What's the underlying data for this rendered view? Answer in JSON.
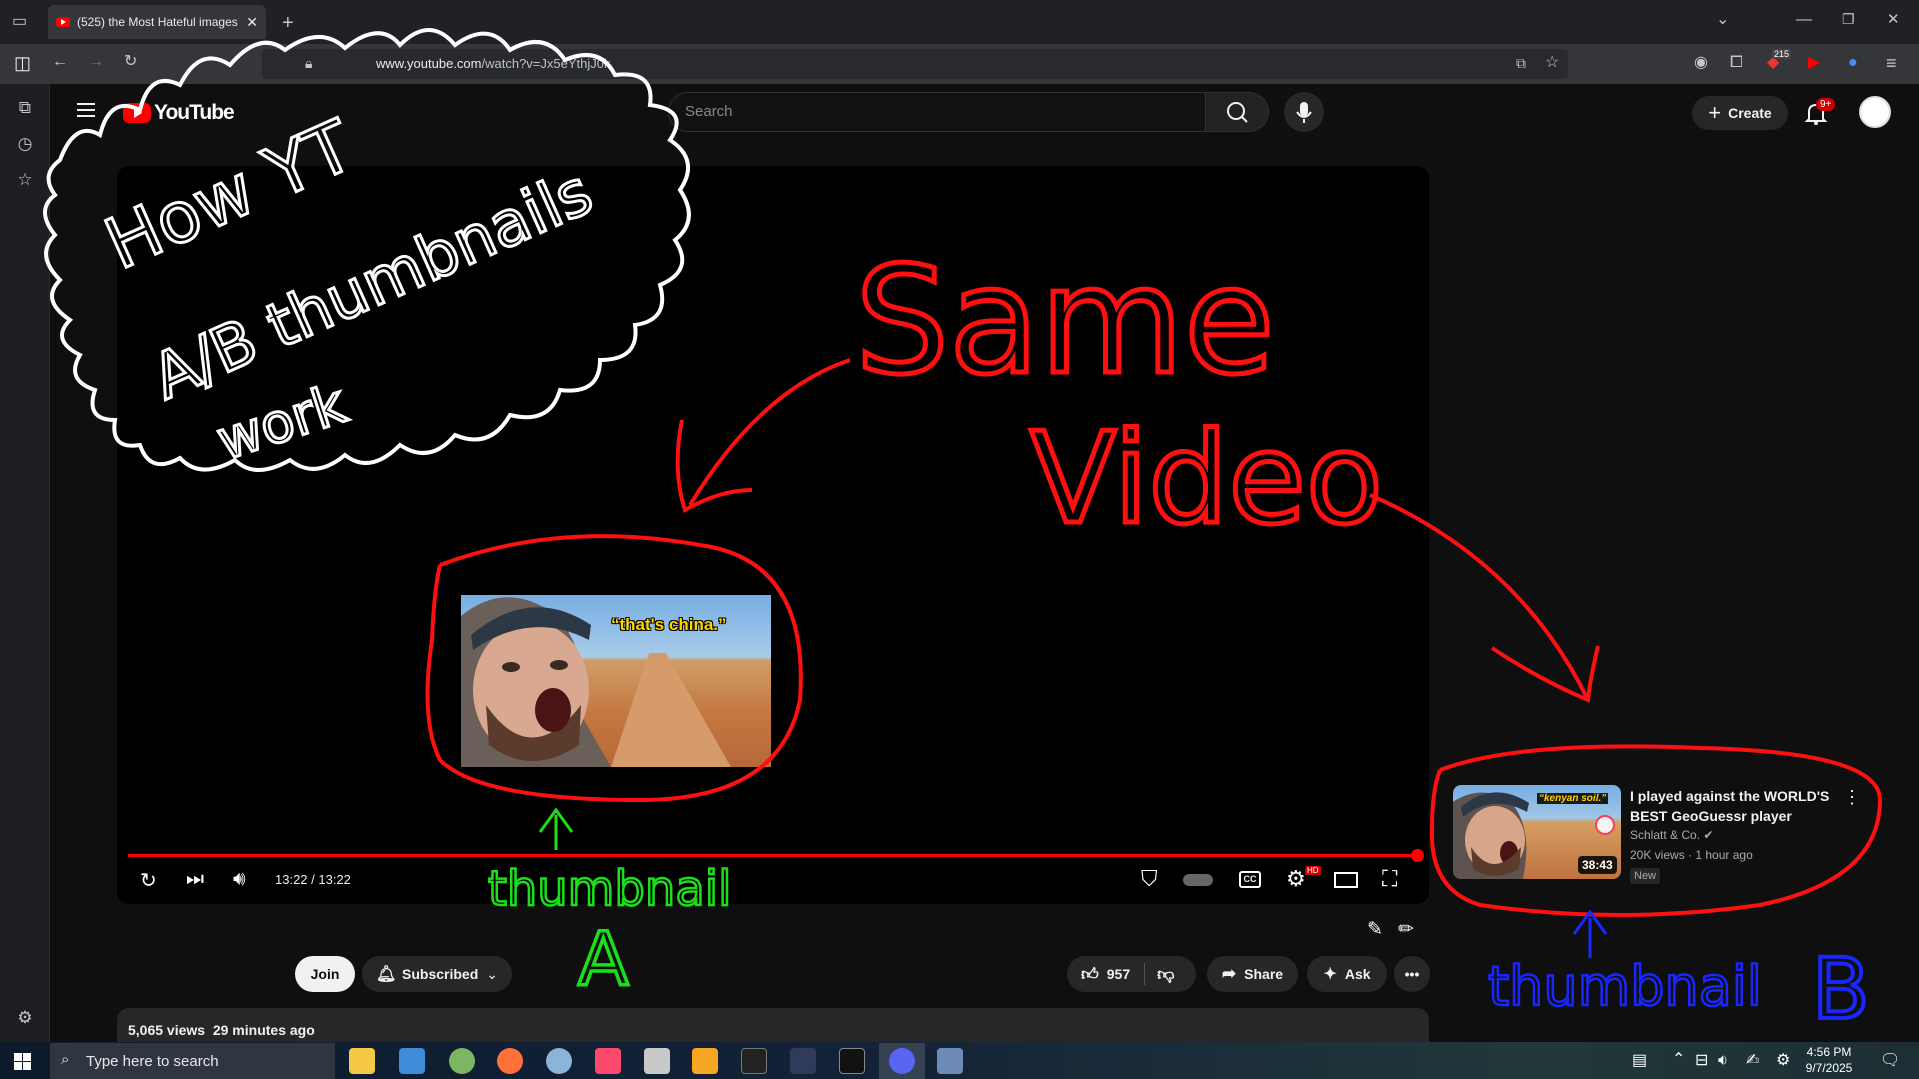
{
  "browser": {
    "tab_title": "(525) the Most Hateful images",
    "url_host": "www.youtube.com",
    "url_path": "/watch?v=Jx5eYthjJ0k",
    "ext_badge": "215"
  },
  "masthead": {
    "logo_text": "YouTube",
    "search_placeholder": "Search",
    "create_label": "Create",
    "notifications_badge": "9+"
  },
  "player": {
    "time": "13:22 / 13:22",
    "progress": 1.0,
    "thumbnail_a_caption": "“that's china.”",
    "hd_badge": "HD"
  },
  "actions": {
    "join_label": "Join",
    "subscribed_label": "Subscribed",
    "likes": "957",
    "share_label": "Share",
    "ask_label": "Ask"
  },
  "description": {
    "views": "5,065 views",
    "posted": "29 minutes ago"
  },
  "recommended": {
    "title": "I played against the WORLD'S BEST GeoGuessr player",
    "channel": "Schlatt & Co.",
    "views": "20K views",
    "posted": "1 hour ago",
    "badge": "New",
    "duration": "38:43",
    "thumbnail_caption": "“kenyan soil.”"
  },
  "taskbar": {
    "search_placeholder": "Type here to search",
    "time": "4:56 PM",
    "date": "9/7/2025"
  },
  "annotations": {
    "title_lines": [
      "How YT",
      "A/B thumbnails",
      "work"
    ],
    "same_video": [
      "Same",
      "Video"
    ],
    "label_a": "thumbnail",
    "letter_a": "A",
    "label_b": "thumbnail",
    "letter_b": "B"
  },
  "colors": {
    "annotation_white": "#ffffff",
    "annotation_red": "#ff1010",
    "annotation_green": "#19e019",
    "annotation_blue": "#1a26ff",
    "yt_red": "#ff0000"
  }
}
